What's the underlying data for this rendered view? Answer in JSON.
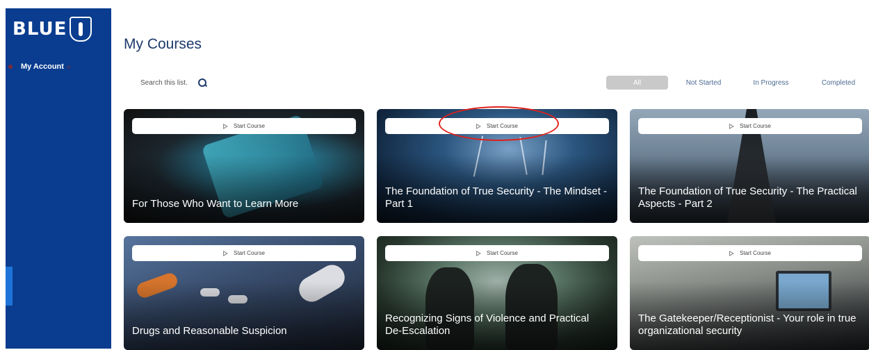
{
  "sidebar": {
    "logo_text": "BLUE",
    "items": [
      {
        "label": "My Account"
      }
    ]
  },
  "page": {
    "title": "My Courses"
  },
  "search": {
    "placeholder": "Search this list."
  },
  "filters": [
    {
      "label": "All",
      "active": true
    },
    {
      "label": "Not Started",
      "active": false
    },
    {
      "label": "In Progress",
      "active": false
    },
    {
      "label": "Completed",
      "active": false
    }
  ],
  "courses": [
    {
      "title": "For Those Who Want to Learn More",
      "button_label": "Start Course"
    },
    {
      "title": "The Foundation of True Security - The Mindset - Part 1",
      "button_label": "Start Course"
    },
    {
      "title": "The Foundation of True Security - The Practical Aspects - Part 2",
      "button_label": "Start Course"
    },
    {
      "title": "Drugs and Reasonable Suspicion",
      "button_label": "Start Course"
    },
    {
      "title": "Recognizing Signs of Violence and Practical De-Escalation",
      "button_label": "Start Course"
    },
    {
      "title": "The Gatekeeper/Receptionist - Your role in true organizational security",
      "button_label": "Start Course"
    }
  ],
  "colors": {
    "sidebar_bg": "#0a3d8f",
    "title_text": "#1d3a6b",
    "filter_active_bg": "#c9c9c9",
    "annotation": "#e0201a"
  }
}
